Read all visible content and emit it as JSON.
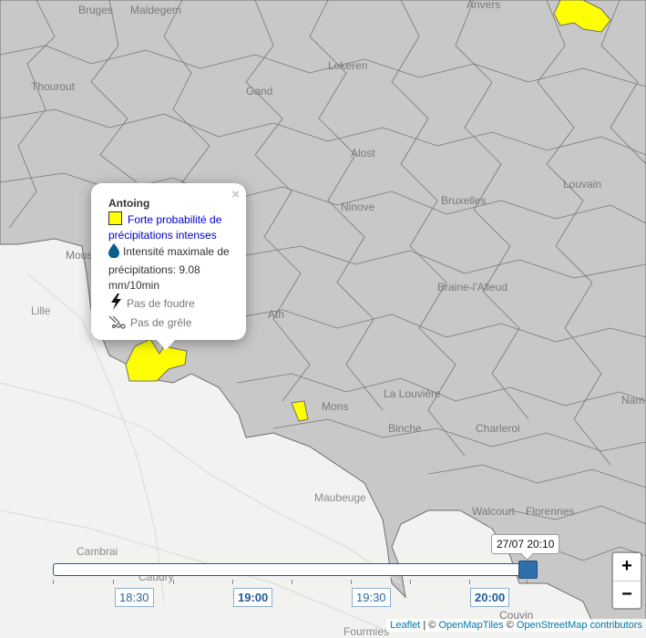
{
  "cities": [
    {
      "name": "Bruges",
      "id": "bruges"
    },
    {
      "name": "Maldegem",
      "id": "maldegem"
    },
    {
      "name": "Anvers",
      "id": "anvers"
    },
    {
      "name": "Lokeren",
      "id": "lokeren"
    },
    {
      "name": "Thourout",
      "id": "thourout"
    },
    {
      "name": "Gand",
      "id": "gand"
    },
    {
      "name": "Alost",
      "id": "alost"
    },
    {
      "name": "Bruxelles",
      "id": "bruxelles"
    },
    {
      "name": "Louvain",
      "id": "louvain"
    },
    {
      "name": "Ninove",
      "id": "ninove"
    },
    {
      "name": "Mous",
      "id": "mouscron"
    },
    {
      "name": "Lille",
      "id": "lille"
    },
    {
      "name": "Braine-l'Alleud",
      "id": "braine"
    },
    {
      "name": "Ath",
      "id": "ath"
    },
    {
      "name": "La Louvière",
      "id": "lalouviere"
    },
    {
      "name": "Mons",
      "id": "mons"
    },
    {
      "name": "Nam",
      "id": "namur"
    },
    {
      "name": "Binche",
      "id": "binche"
    },
    {
      "name": "Charleroi",
      "id": "charleroi"
    },
    {
      "name": "Maubeuge",
      "id": "maubeuge"
    },
    {
      "name": "Walcourt",
      "id": "walcourt"
    },
    {
      "name": "Florennes",
      "id": "florennes"
    },
    {
      "name": "Cambrai",
      "id": "cambrai"
    },
    {
      "name": "Caudry",
      "id": "caudry"
    },
    {
      "name": "Couvin",
      "id": "couvin"
    },
    {
      "name": "Fourmies",
      "id": "fourmies"
    }
  ],
  "popup": {
    "title": "Antoing",
    "alert": "Forte probabilité de précipitations intenses",
    "intensity": "Intensité maximale de précipitations: 9.08 mm/10min",
    "lightning": "Pas de foudre",
    "hail": "Pas de grêle",
    "close": "×"
  },
  "zoom": {
    "in": "+",
    "out": "−"
  },
  "timeline": {
    "labels": [
      "18:30",
      "19:00",
      "19:30",
      "20:00"
    ],
    "current": "27/07 20:10",
    "position_fraction": 1.0
  },
  "attribution": {
    "leaflet": "Leaflet",
    "sep1": " | © ",
    "tiles": "OpenMapTiles",
    "sep2": " © ",
    "osm": "OpenStreetMap contributors"
  },
  "colors": {
    "land_grey": "#c8c8c8",
    "border": "#6e6e6e",
    "france": "#f2f2f0",
    "alert_yellow": "#ffff00",
    "timeline_accent": "#2f6fab"
  }
}
